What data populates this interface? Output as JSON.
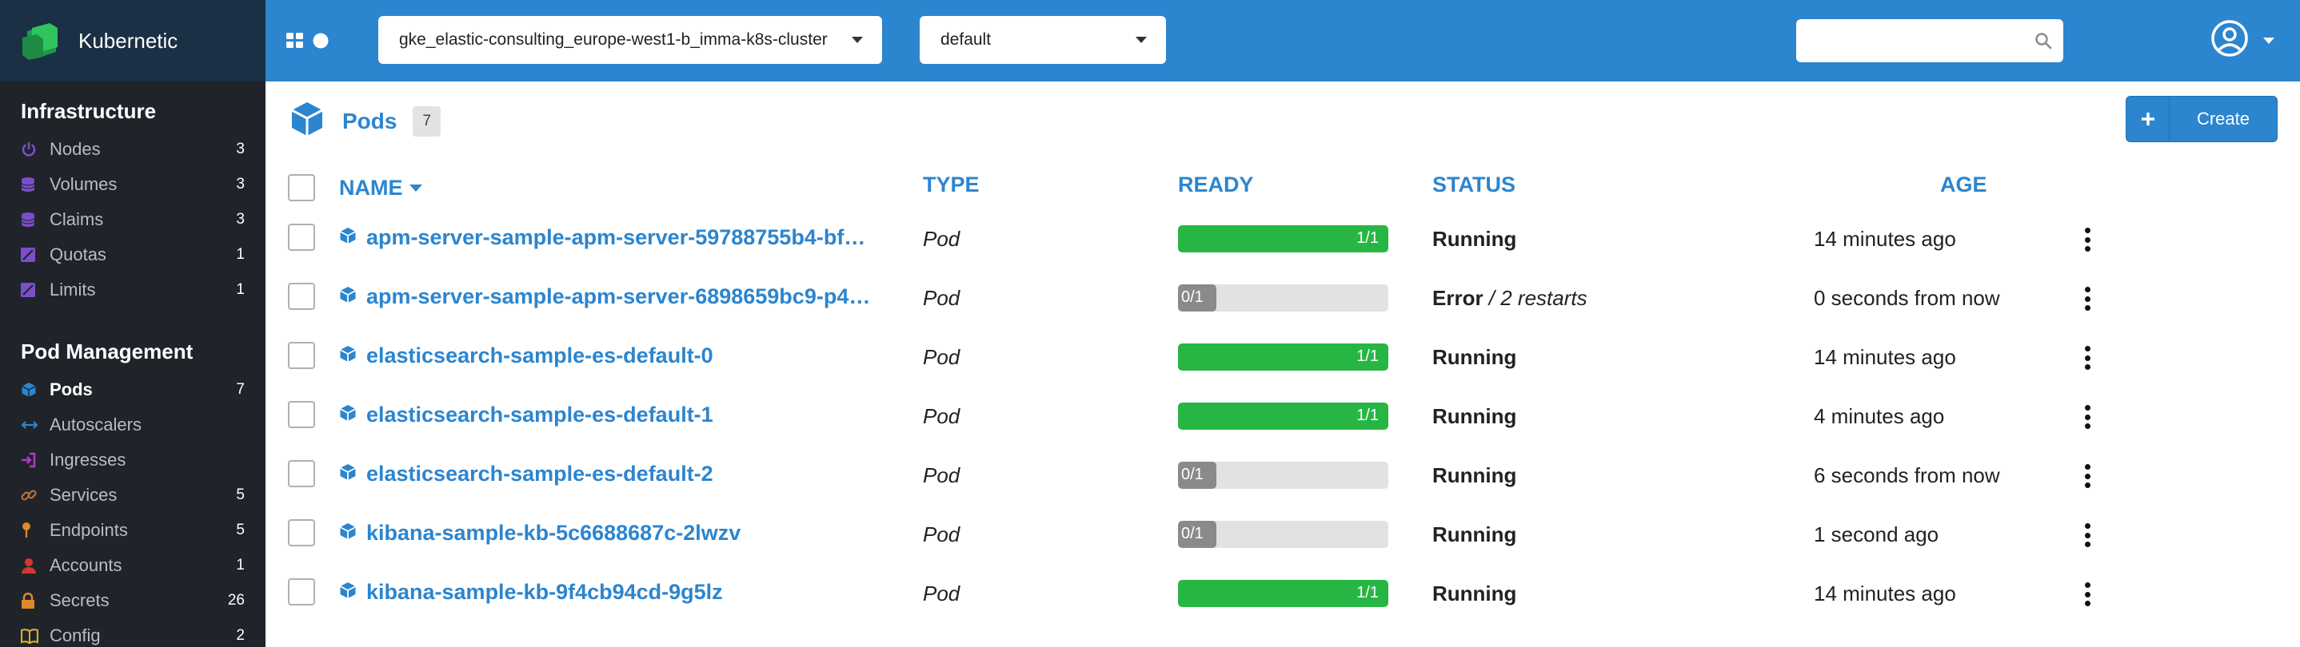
{
  "app": {
    "name": "Kubernetic",
    "brand_color": "#2c85cf",
    "sidebar_bg": "#20242a"
  },
  "sidebar": {
    "infrastructure": {
      "heading": "Infrastructure",
      "items": [
        {
          "label": "Nodes",
          "count": "3",
          "icon": "power-icon",
          "icon_color": "#7b4fc9"
        },
        {
          "label": "Volumes",
          "count": "3",
          "icon": "database-icon",
          "icon_color": "#7b4fc9"
        },
        {
          "label": "Claims",
          "count": "3",
          "icon": "database-icon",
          "icon_color": "#7b4fc9"
        },
        {
          "label": "Quotas",
          "count": "1",
          "icon": "chart-square-icon",
          "icon_color": "#7b4fc9"
        },
        {
          "label": "Limits",
          "count": "1",
          "icon": "chart-square-icon",
          "icon_color": "#7b4fc9"
        }
      ]
    },
    "pod_management": {
      "heading": "Pod Management",
      "items": [
        {
          "label": "Pods",
          "count": "7",
          "icon": "cube-icon",
          "icon_color": "#2c85cf",
          "active": true
        },
        {
          "label": "Autoscalers",
          "count": "",
          "icon": "arrows-horizontal-icon",
          "icon_color": "#2c85cf"
        },
        {
          "label": "Ingresses",
          "count": "",
          "icon": "sign-in-icon",
          "icon_color": "#b13bc7"
        },
        {
          "label": "Services",
          "count": "5",
          "icon": "link-icon",
          "icon_color": "#b5713b"
        },
        {
          "label": "Endpoints",
          "count": "5",
          "icon": "pin-icon",
          "icon_color": "#e0892c"
        },
        {
          "label": "Accounts",
          "count": "1",
          "icon": "user-icon",
          "icon_color": "#d33a2c"
        },
        {
          "label": "Secrets",
          "count": "26",
          "icon": "lock-icon",
          "icon_color": "#e0892c"
        },
        {
          "label": "Config",
          "count": "2",
          "icon": "book-icon",
          "icon_color": "#d6b02c"
        }
      ]
    }
  },
  "topbar": {
    "cluster": "gke_elastic-consulting_europe-west1-b_imma-k8s-cluster",
    "namespace": "default",
    "search_placeholder": ""
  },
  "main": {
    "title": "Pods",
    "count": "7",
    "create_label": "Create",
    "columns": {
      "name": "NAME",
      "type": "TYPE",
      "ready": "READY",
      "status": "STATUS",
      "age": "AGE"
    },
    "rows": [
      {
        "name": "apm-server-sample-apm-server-59788755b4-bf…",
        "type": "Pod",
        "ready": "1/1",
        "ready_fraction": 1,
        "status": "Running",
        "status_extra": "",
        "age": "14 minutes ago"
      },
      {
        "name": "apm-server-sample-apm-server-6898659bc9-p4…",
        "type": "Pod",
        "ready": "0/1",
        "ready_fraction": 0,
        "status": "Error",
        "status_extra": " / 2 restarts",
        "age": "0 seconds from now"
      },
      {
        "name": "elasticsearch-sample-es-default-0",
        "type": "Pod",
        "ready": "1/1",
        "ready_fraction": 1,
        "status": "Running",
        "status_extra": "",
        "age": "14 minutes ago"
      },
      {
        "name": "elasticsearch-sample-es-default-1",
        "type": "Pod",
        "ready": "1/1",
        "ready_fraction": 1,
        "status": "Running",
        "status_extra": "",
        "age": "4 minutes ago"
      },
      {
        "name": "elasticsearch-sample-es-default-2",
        "type": "Pod",
        "ready": "0/1",
        "ready_fraction": 0,
        "status": "Running",
        "status_extra": "",
        "age": "6 seconds from now"
      },
      {
        "name": "kibana-sample-kb-5c6688687c-2lwzv",
        "type": "Pod",
        "ready": "0/1",
        "ready_fraction": 0,
        "status": "Running",
        "status_extra": "",
        "age": "1 second ago"
      },
      {
        "name": "kibana-sample-kb-9f4cb94cd-9g5lz",
        "type": "Pod",
        "ready": "1/1",
        "ready_fraction": 1,
        "status": "Running",
        "status_extra": "",
        "age": "14 minutes ago"
      }
    ]
  }
}
